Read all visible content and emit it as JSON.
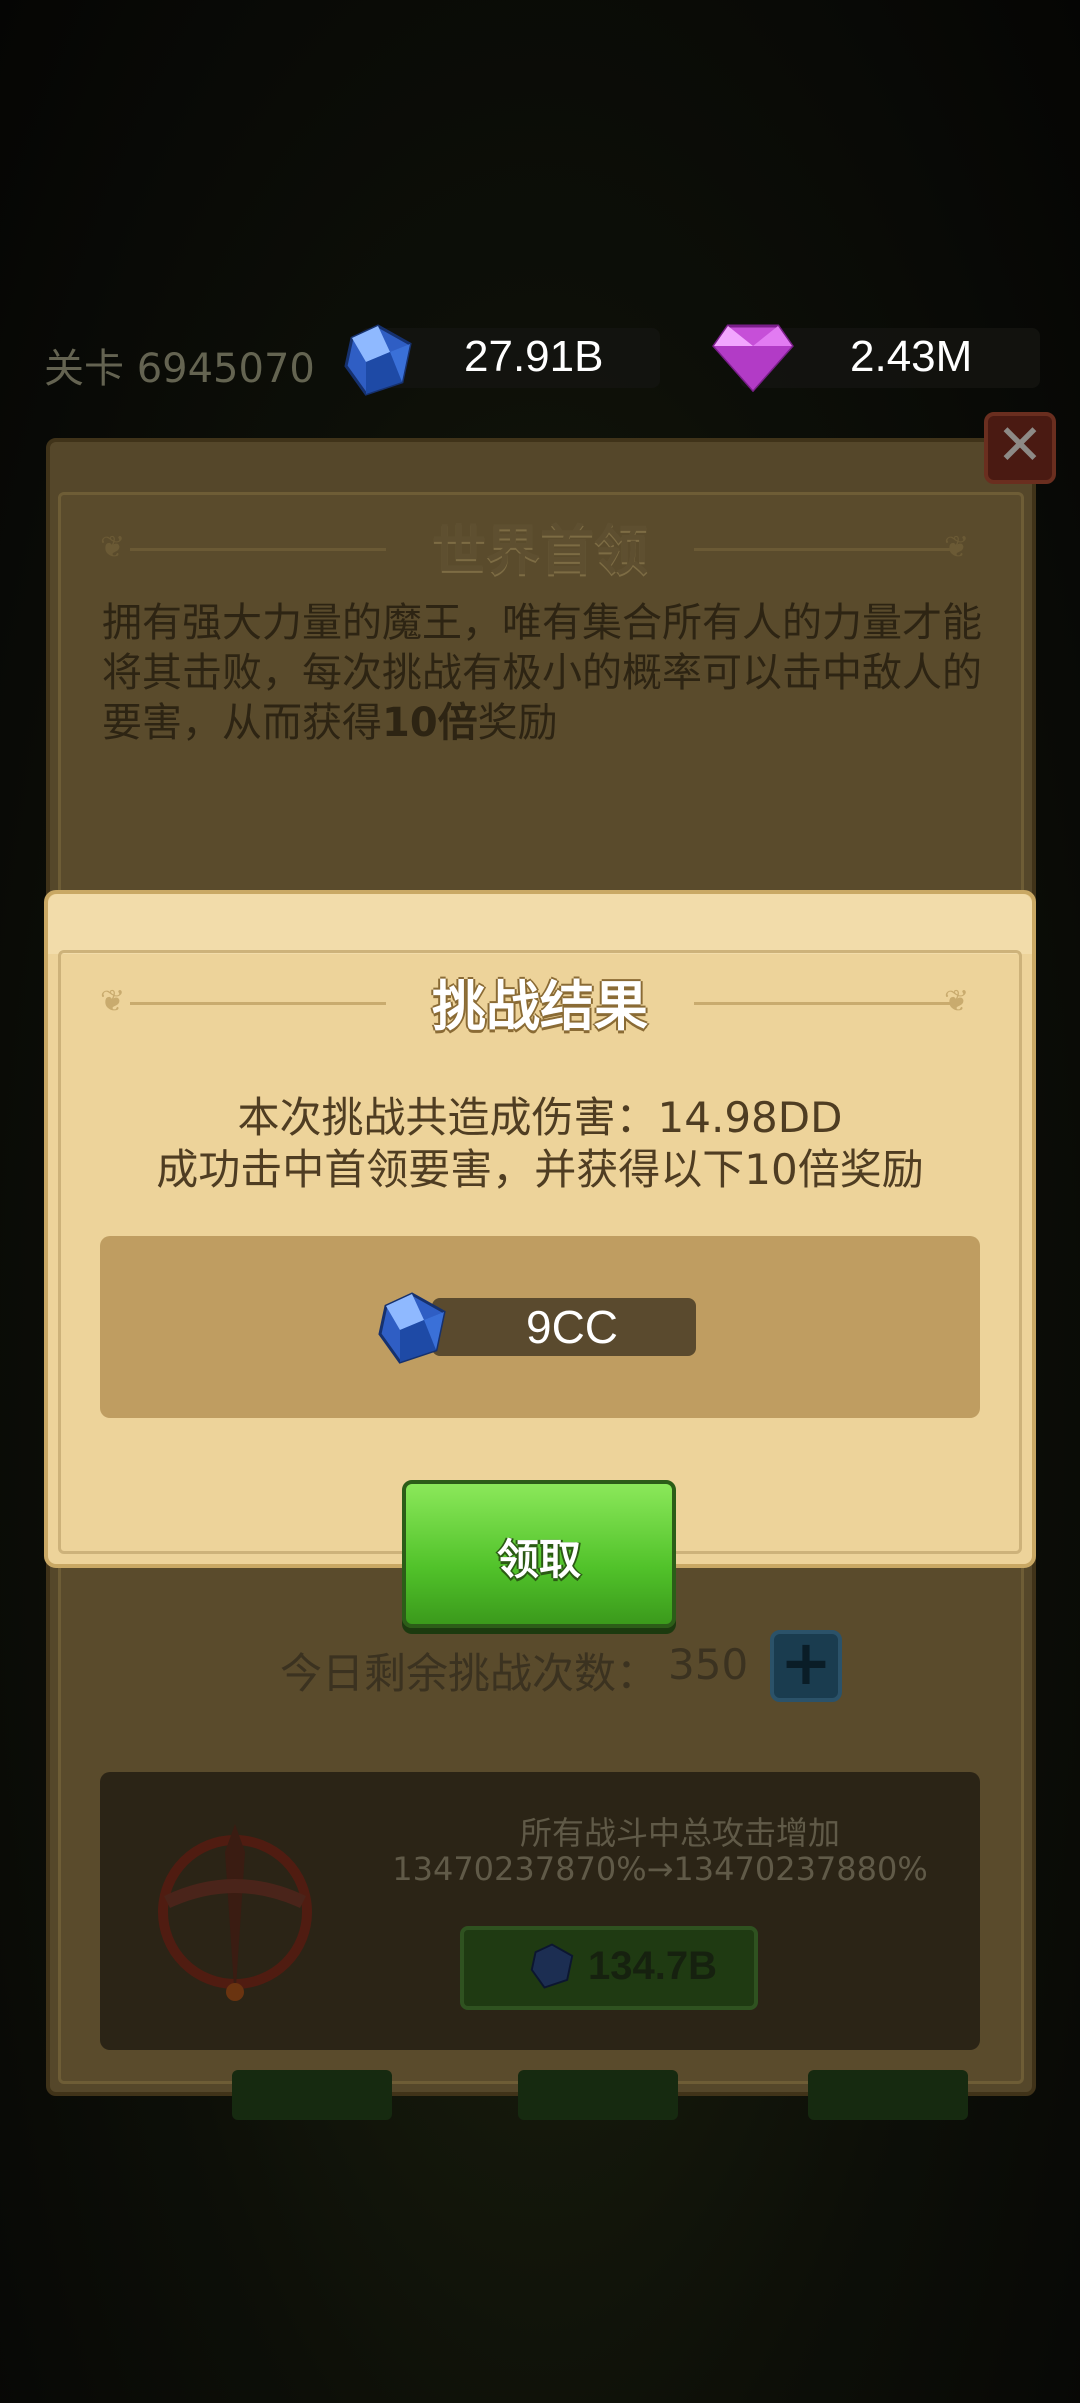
{
  "top_bar": {
    "level_text": "关卡 6945070",
    "sapphire_value": "27.91B",
    "diamond_value": "2.43M"
  },
  "panel": {
    "title": "世界首领",
    "description_plain": "拥有强大力量的魔王，唯有集合所有人的力量才能将其击败，每次挑战有极小的概率可以击中敌人的要害，从而获得",
    "description_bold": "10倍",
    "description_end": "奖励",
    "remaining_label": "今日剩余挑战次数：",
    "remaining_count": "350",
    "upgrade_desc_1": "所有战斗中总攻击增加",
    "upgrade_desc_2": "13470237870%→13470237880%",
    "upgrade_cost": "134.7B"
  },
  "modal": {
    "title": "挑战结果",
    "line1": "本次挑战共造成伤害：14.98DD",
    "line2": "成功击中首领要害，并获得以下10倍奖励",
    "reward_value": "9CC",
    "claim_label": "领取"
  },
  "colors": {
    "modal_bg": "#edd39a",
    "claim_green": "#51c22a",
    "panel_dim": "#55472a"
  },
  "icons": [
    "sapphire-icon",
    "diamond-icon",
    "close-icon",
    "plus-icon",
    "crossbow-icon"
  ]
}
